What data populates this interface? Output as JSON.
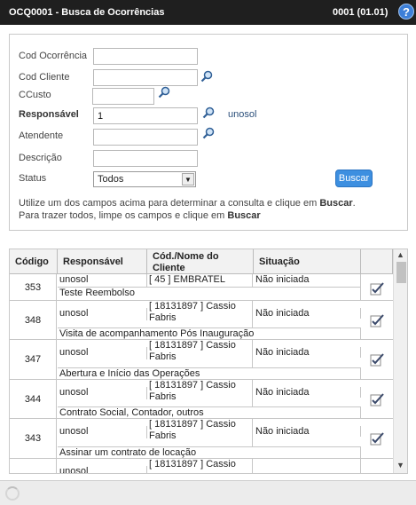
{
  "header": {
    "title": "OCQ0001 - Busca de Ocorrências",
    "version": "0001 (01.01)",
    "help_glyph": "?"
  },
  "form": {
    "cod_ocorrencia_label": "Cod Ocorrência",
    "cod_ocorrencia_value": "",
    "cod_cliente_label": "Cod Cliente",
    "cod_cliente_value": "",
    "ccusto_label": "CCusto",
    "ccusto_value": "",
    "responsavel_label": "Responsável",
    "responsavel_value": "1",
    "responsavel_name": "unosol",
    "atendente_label": "Atendente",
    "atendente_value": "",
    "descricao_label": "Descrição",
    "descricao_value": "",
    "status_label": "Status",
    "status_value": "Todos",
    "search_button": "Buscar",
    "info_line1_a": "Utilize um dos campos acima para determinar a consulta e clique em ",
    "info_line1_b": "Buscar",
    "info_line1_c": ".",
    "info_line2_a": "Para trazer todos, limpe os campos e clique em ",
    "info_line2_b": "Buscar"
  },
  "grid": {
    "columns": [
      "Código",
      "Responsável",
      "Cód./Nome do Cliente",
      "Situação"
    ],
    "rows": [
      {
        "codigo": "353",
        "responsavel": "unosol",
        "cliente": "[ 45 ] EMBRATEL",
        "situacao": "Não iniciada",
        "descricao": "Teste Reembolso"
      },
      {
        "codigo": "348",
        "responsavel": "unosol",
        "cliente": "[ 18131897 ] Cassio Fabris",
        "situacao": "Não iniciada",
        "descricao": "Visita de acompanhamento Pós Inauguração"
      },
      {
        "codigo": "347",
        "responsavel": "unosol",
        "cliente": "[ 18131897 ] Cassio Fabris",
        "situacao": "Não iniciada",
        "descricao": "Abertura e Início das Operações"
      },
      {
        "codigo": "344",
        "responsavel": "unosol",
        "cliente": "[ 18131897 ] Cassio Fabris",
        "situacao": "Não iniciada",
        "descricao": "Contrato Social, Contador, outros"
      },
      {
        "codigo": "343",
        "responsavel": "unosol",
        "cliente": "[ 18131897 ] Cassio Fabris",
        "situacao": "Não iniciada",
        "descricao": "Assinar um contrato de locação"
      },
      {
        "codigo": "",
        "responsavel": "unosol",
        "cliente": "[ 18131897 ] Cassio",
        "situacao": "",
        "descricao": ""
      }
    ]
  },
  "icons": {
    "search": "magnifier-icon",
    "edit": "edit-check-icon",
    "help": "help-icon",
    "loading": "spinner-icon"
  }
}
